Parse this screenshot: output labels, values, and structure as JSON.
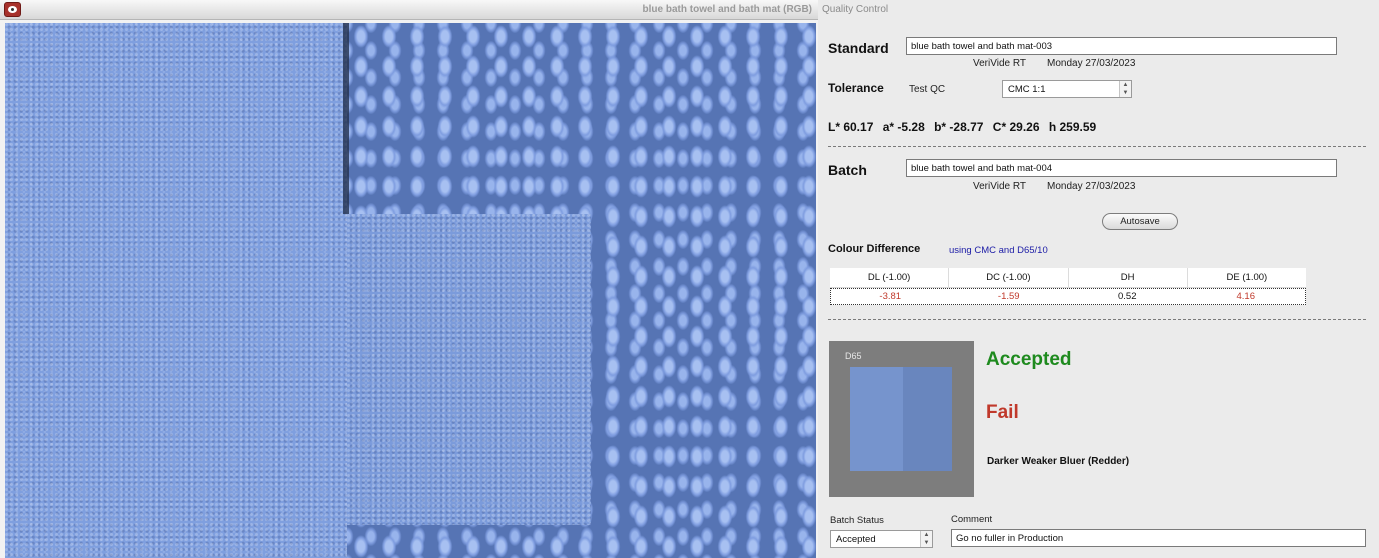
{
  "viewer": {
    "title": "blue bath towel and bath mat (RGB)"
  },
  "panel": {
    "title": "Quality Control",
    "standard": {
      "label": "Standard",
      "name": "blue bath towel and bath mat-003",
      "device": "VeriVide RT",
      "date": "Monday 27/03/2023"
    },
    "tolerance": {
      "label": "Tolerance",
      "name": "Test QC",
      "formula": "CMC 1:1"
    },
    "lab": {
      "L": "L* 60.17",
      "a": "a* -5.28",
      "b": "b* -28.77",
      "C": "C* 29.26",
      "h": "h 259.59"
    },
    "batch": {
      "label": "Batch",
      "name": "blue bath towel and bath mat-004",
      "device": "VeriVide RT",
      "date": "Monday 27/03/2023"
    },
    "autosave_label": "Autosave",
    "colour_difference": {
      "label": "Colour Difference",
      "method": "using CMC and D65/10",
      "headers": [
        "DL (-1.00)",
        "DC (-1.00)",
        "DH",
        "DE (1.00)"
      ],
      "values": [
        "-3.81",
        "-1.59",
        "0.52",
        "4.16"
      ]
    },
    "swatch": {
      "illuminant": "D65",
      "standard_color": "#7694cd",
      "batch_color": "#6986be"
    },
    "verdict": {
      "accepted": "Accepted",
      "fail": "Fail",
      "description": "Darker Weaker Bluer (Redder)"
    },
    "batch_status": {
      "label": "Batch Status",
      "value": "Accepted"
    },
    "comment": {
      "label": "Comment",
      "value": "Go no fuller in Production"
    },
    "colors": {
      "accepted": "#1e8a1e",
      "fail": "#c0392b",
      "method_text": "#1b1ba6"
    }
  }
}
